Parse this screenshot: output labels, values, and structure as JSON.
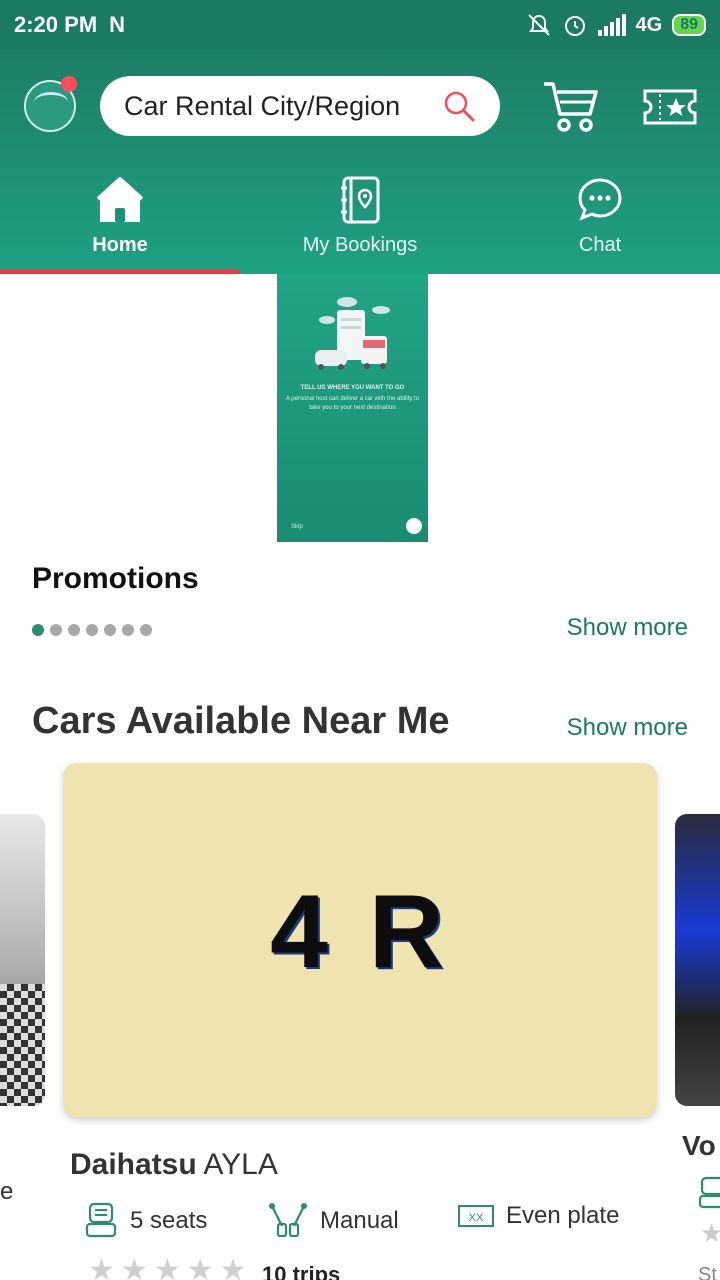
{
  "status_bar": {
    "time": "2:20 PM",
    "notif": "N",
    "network": "4G",
    "battery": "89"
  },
  "header": {
    "search_placeholder": "Car Rental City/Region",
    "brand_color": "#1d8b70"
  },
  "tabs": [
    {
      "label": "Home",
      "icon": "home-icon",
      "active": true
    },
    {
      "label": "My Bookings",
      "icon": "bookings-icon",
      "active": false
    },
    {
      "label": "Chat",
      "icon": "chat-icon",
      "active": false
    }
  ],
  "banner": {
    "headline": "TELL US WHERE YOU WANT TO GO",
    "body": "A personal host can deliver a car with the ability to take you to your next destination",
    "skip": "Skip"
  },
  "promotions": {
    "title": "Promotions",
    "show_more": "Show more",
    "dot_count": 7,
    "active_dot": 0
  },
  "cars_section": {
    "title": "Cars Available Near Me",
    "show_more": "Show more"
  },
  "featured_car": {
    "image_text": "4 R",
    "brand": "Daihatsu",
    "model": "AYLA",
    "seats": "5 seats",
    "transmission": "Manual",
    "plate": "Even plate",
    "plate_icon_text": "XX",
    "rating": 0,
    "trips": "10 trips"
  },
  "next_car": {
    "name_fragment": "Vo",
    "sub_fragment": "St"
  },
  "prev_car": {
    "fragment": "e"
  }
}
